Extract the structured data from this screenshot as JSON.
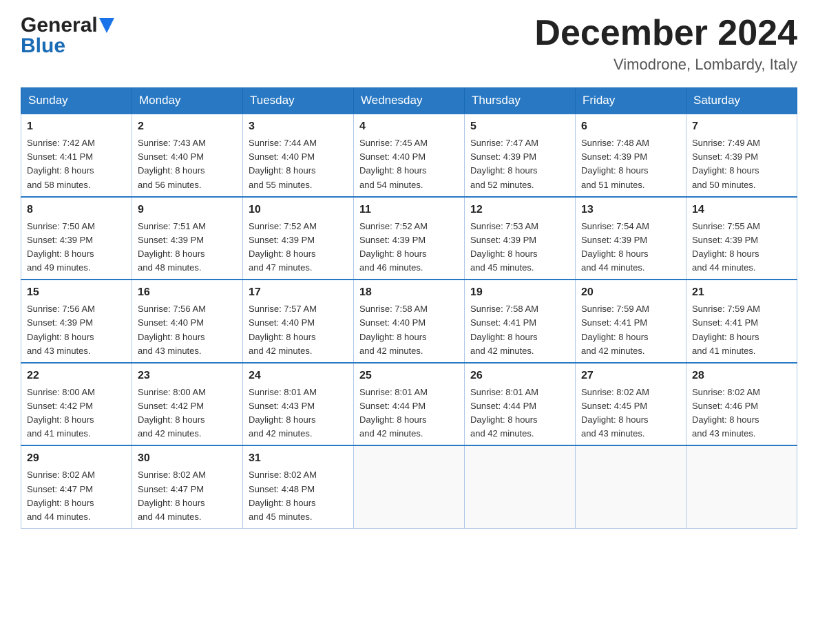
{
  "header": {
    "logo_line1": "General",
    "logo_line2": "Blue",
    "month_title": "December 2024",
    "location": "Vimodrone, Lombardy, Italy"
  },
  "days_of_week": [
    "Sunday",
    "Monday",
    "Tuesday",
    "Wednesday",
    "Thursday",
    "Friday",
    "Saturday"
  ],
  "weeks": [
    [
      {
        "num": "1",
        "sunrise": "7:42 AM",
        "sunset": "4:41 PM",
        "daylight": "8 hours and 58 minutes."
      },
      {
        "num": "2",
        "sunrise": "7:43 AM",
        "sunset": "4:40 PM",
        "daylight": "8 hours and 56 minutes."
      },
      {
        "num": "3",
        "sunrise": "7:44 AM",
        "sunset": "4:40 PM",
        "daylight": "8 hours and 55 minutes."
      },
      {
        "num": "4",
        "sunrise": "7:45 AM",
        "sunset": "4:40 PM",
        "daylight": "8 hours and 54 minutes."
      },
      {
        "num": "5",
        "sunrise": "7:47 AM",
        "sunset": "4:39 PM",
        "daylight": "8 hours and 52 minutes."
      },
      {
        "num": "6",
        "sunrise": "7:48 AM",
        "sunset": "4:39 PM",
        "daylight": "8 hours and 51 minutes."
      },
      {
        "num": "7",
        "sunrise": "7:49 AM",
        "sunset": "4:39 PM",
        "daylight": "8 hours and 50 minutes."
      }
    ],
    [
      {
        "num": "8",
        "sunrise": "7:50 AM",
        "sunset": "4:39 PM",
        "daylight": "8 hours and 49 minutes."
      },
      {
        "num": "9",
        "sunrise": "7:51 AM",
        "sunset": "4:39 PM",
        "daylight": "8 hours and 48 minutes."
      },
      {
        "num": "10",
        "sunrise": "7:52 AM",
        "sunset": "4:39 PM",
        "daylight": "8 hours and 47 minutes."
      },
      {
        "num": "11",
        "sunrise": "7:52 AM",
        "sunset": "4:39 PM",
        "daylight": "8 hours and 46 minutes."
      },
      {
        "num": "12",
        "sunrise": "7:53 AM",
        "sunset": "4:39 PM",
        "daylight": "8 hours and 45 minutes."
      },
      {
        "num": "13",
        "sunrise": "7:54 AM",
        "sunset": "4:39 PM",
        "daylight": "8 hours and 44 minutes."
      },
      {
        "num": "14",
        "sunrise": "7:55 AM",
        "sunset": "4:39 PM",
        "daylight": "8 hours and 44 minutes."
      }
    ],
    [
      {
        "num": "15",
        "sunrise": "7:56 AM",
        "sunset": "4:39 PM",
        "daylight": "8 hours and 43 minutes."
      },
      {
        "num": "16",
        "sunrise": "7:56 AM",
        "sunset": "4:40 PM",
        "daylight": "8 hours and 43 minutes."
      },
      {
        "num": "17",
        "sunrise": "7:57 AM",
        "sunset": "4:40 PM",
        "daylight": "8 hours and 42 minutes."
      },
      {
        "num": "18",
        "sunrise": "7:58 AM",
        "sunset": "4:40 PM",
        "daylight": "8 hours and 42 minutes."
      },
      {
        "num": "19",
        "sunrise": "7:58 AM",
        "sunset": "4:41 PM",
        "daylight": "8 hours and 42 minutes."
      },
      {
        "num": "20",
        "sunrise": "7:59 AM",
        "sunset": "4:41 PM",
        "daylight": "8 hours and 42 minutes."
      },
      {
        "num": "21",
        "sunrise": "7:59 AM",
        "sunset": "4:41 PM",
        "daylight": "8 hours and 41 minutes."
      }
    ],
    [
      {
        "num": "22",
        "sunrise": "8:00 AM",
        "sunset": "4:42 PM",
        "daylight": "8 hours and 41 minutes."
      },
      {
        "num": "23",
        "sunrise": "8:00 AM",
        "sunset": "4:42 PM",
        "daylight": "8 hours and 42 minutes."
      },
      {
        "num": "24",
        "sunrise": "8:01 AM",
        "sunset": "4:43 PM",
        "daylight": "8 hours and 42 minutes."
      },
      {
        "num": "25",
        "sunrise": "8:01 AM",
        "sunset": "4:44 PM",
        "daylight": "8 hours and 42 minutes."
      },
      {
        "num": "26",
        "sunrise": "8:01 AM",
        "sunset": "4:44 PM",
        "daylight": "8 hours and 42 minutes."
      },
      {
        "num": "27",
        "sunrise": "8:02 AM",
        "sunset": "4:45 PM",
        "daylight": "8 hours and 43 minutes."
      },
      {
        "num": "28",
        "sunrise": "8:02 AM",
        "sunset": "4:46 PM",
        "daylight": "8 hours and 43 minutes."
      }
    ],
    [
      {
        "num": "29",
        "sunrise": "8:02 AM",
        "sunset": "4:47 PM",
        "daylight": "8 hours and 44 minutes."
      },
      {
        "num": "30",
        "sunrise": "8:02 AM",
        "sunset": "4:47 PM",
        "daylight": "8 hours and 44 minutes."
      },
      {
        "num": "31",
        "sunrise": "8:02 AM",
        "sunset": "4:48 PM",
        "daylight": "8 hours and 45 minutes."
      },
      null,
      null,
      null,
      null
    ]
  ]
}
